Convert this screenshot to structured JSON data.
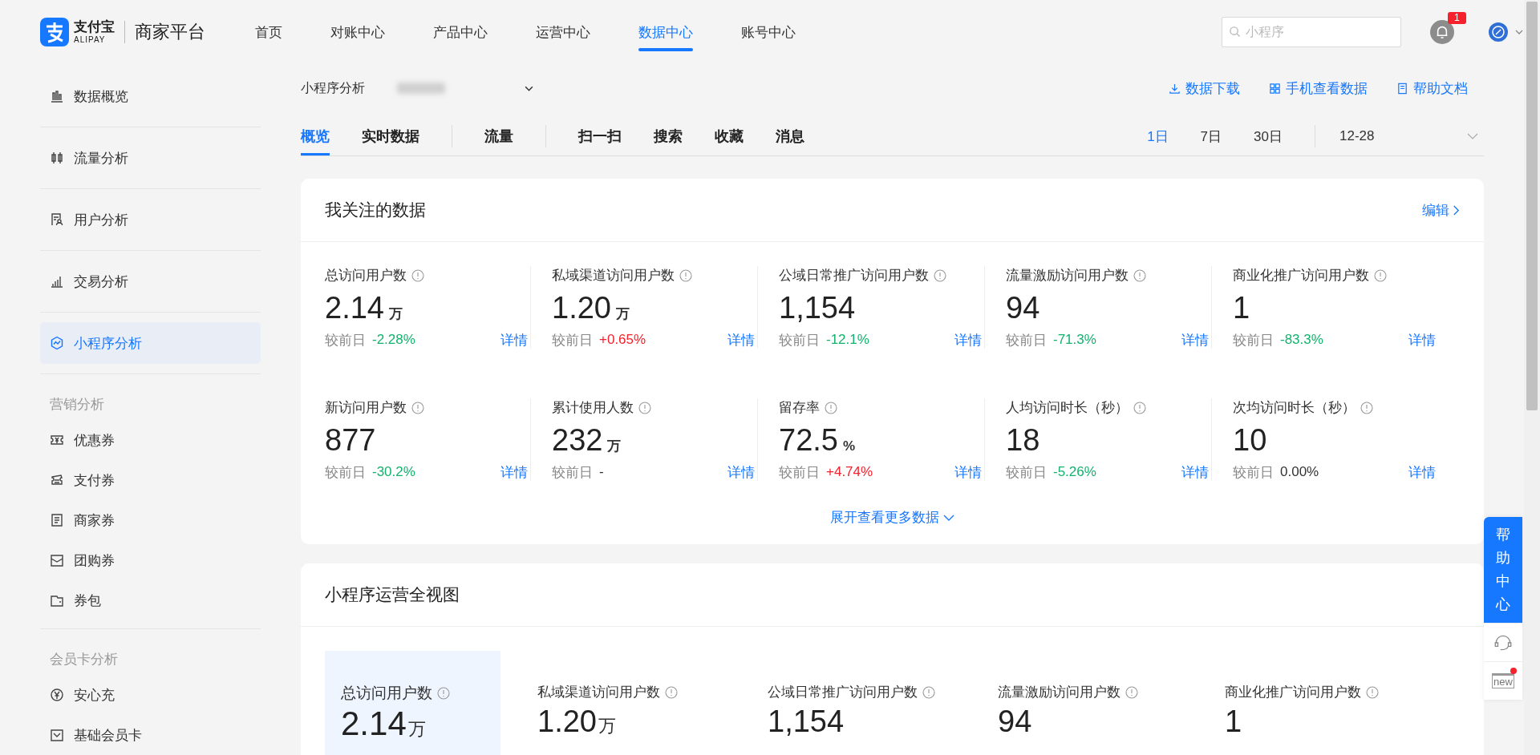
{
  "header": {
    "logo_cn": "支付宝",
    "logo_en": "ALIPAY",
    "platform": "商家平台",
    "nav": [
      {
        "label": "首页",
        "selected": false
      },
      {
        "label": "对账中心",
        "selected": false
      },
      {
        "label": "产品中心",
        "selected": false
      },
      {
        "label": "运营中心",
        "selected": false
      },
      {
        "label": "数据中心",
        "selected": true
      },
      {
        "label": "账号中心",
        "selected": false
      }
    ],
    "search": {
      "placeholder": "小程序"
    },
    "notification_count": "1"
  },
  "sidebar": {
    "items": [
      {
        "label": "数据概览",
        "selected": false
      },
      {
        "label": "流量分析",
        "selected": false
      },
      {
        "label": "用户分析",
        "selected": false
      },
      {
        "label": "交易分析",
        "selected": false
      },
      {
        "label": "小程序分析",
        "selected": true
      }
    ],
    "sections": [
      {
        "title": "营销分析",
        "items": [
          {
            "label": "优惠券",
            "selected": false
          },
          {
            "label": "支付券",
            "selected": false
          },
          {
            "label": "商家券",
            "selected": false
          },
          {
            "label": "团购券",
            "selected": false
          },
          {
            "label": "券包",
            "selected": false
          }
        ]
      },
      {
        "title": "会员卡分析",
        "items": [
          {
            "label": "安心充",
            "selected": false
          },
          {
            "label": "基础会员卡",
            "selected": false
          }
        ]
      }
    ]
  },
  "page": {
    "title": "小程序分析",
    "actions": [
      "数据下载",
      "手机查看数据",
      "帮助文档"
    ],
    "tab_groups": [
      [
        {
          "label": "概览",
          "selected": true
        },
        {
          "label": "实时数据",
          "selected": false
        }
      ],
      [
        {
          "label": "流量",
          "selected": false
        }
      ],
      [
        {
          "label": "扫一扫",
          "selected": false
        },
        {
          "label": "搜索",
          "selected": false
        },
        {
          "label": "收藏",
          "selected": false
        },
        {
          "label": "消息",
          "selected": false
        }
      ]
    ],
    "ranges": [
      {
        "label": "1日",
        "selected": true
      },
      {
        "label": "7日",
        "selected": false
      },
      {
        "label": "30日",
        "selected": false
      }
    ],
    "date": "12-28"
  },
  "focus_card": {
    "title": "我关注的数据",
    "edit": "编辑",
    "more": "展开查看更多数据",
    "metrics": [
      {
        "label": "总访问用户数",
        "value": "2.14",
        "unit": "万",
        "compare_label": "较前日",
        "delta": "-2.28%",
        "color": "#13b36d",
        "detail": "详情"
      },
      {
        "label": "私域渠道访问用户数",
        "value": "1.20",
        "unit": "万",
        "compare_label": "较前日",
        "delta": "+0.65%",
        "color": "#f5222d",
        "detail": "详情"
      },
      {
        "label": "公域日常推广访问用户数",
        "value": "1,154",
        "compare_label": "较前日",
        "delta": "-12.1%",
        "color": "#13b36d",
        "detail": "详情"
      },
      {
        "label": "流量激励访问用户数",
        "value": "94",
        "compare_label": "较前日",
        "delta": "-71.3%",
        "color": "#13b36d",
        "detail": "详情"
      },
      {
        "label": "商业化推广访问用户数",
        "value": "1",
        "compare_label": "较前日",
        "delta": "-83.3%",
        "color": "#13b36d",
        "detail": "详情"
      },
      {
        "label": "新访问用户数",
        "value": "877",
        "compare_label": "较前日",
        "delta": "-30.2%",
        "color": "#13b36d",
        "detail": "详情"
      },
      {
        "label": "累计使用人数",
        "value": "232",
        "unit": "万",
        "compare_label": "较前日",
        "delta": "-",
        "color": "#333333",
        "detail": "详情"
      },
      {
        "label": "留存率",
        "value": "72.5",
        "unit": "%",
        "compare_label": "较前日",
        "delta": "+4.74%",
        "color": "#f5222d",
        "detail": "详情"
      },
      {
        "label": "人均访问时长（秒）",
        "value": "18",
        "compare_label": "较前日",
        "delta": "-5.26%",
        "color": "#13b36d",
        "detail": "详情"
      },
      {
        "label": "次均访问时长（秒）",
        "value": "10",
        "compare_label": "较前日",
        "delta": "0.00%",
        "color": "#333333",
        "detail": "详情"
      }
    ]
  },
  "overview_card": {
    "title": "小程序运营全视图",
    "metrics": [
      {
        "label": "总访问用户数",
        "value": "2.14",
        "unit": "万",
        "selected": true
      },
      {
        "label": "私域渠道访问用户数",
        "value": "1.20",
        "unit": "万",
        "selected": false
      },
      {
        "label": "公域日常推广访问用户数",
        "value": "1,154",
        "selected": false
      },
      {
        "label": "流量激励访问用户数",
        "value": "94",
        "selected": false
      },
      {
        "label": "商业化推广访问用户数",
        "value": "1",
        "selected": false
      }
    ]
  },
  "float_panel": {
    "help": "帮助中心",
    "new_label": "new",
    "new_dot": true
  }
}
